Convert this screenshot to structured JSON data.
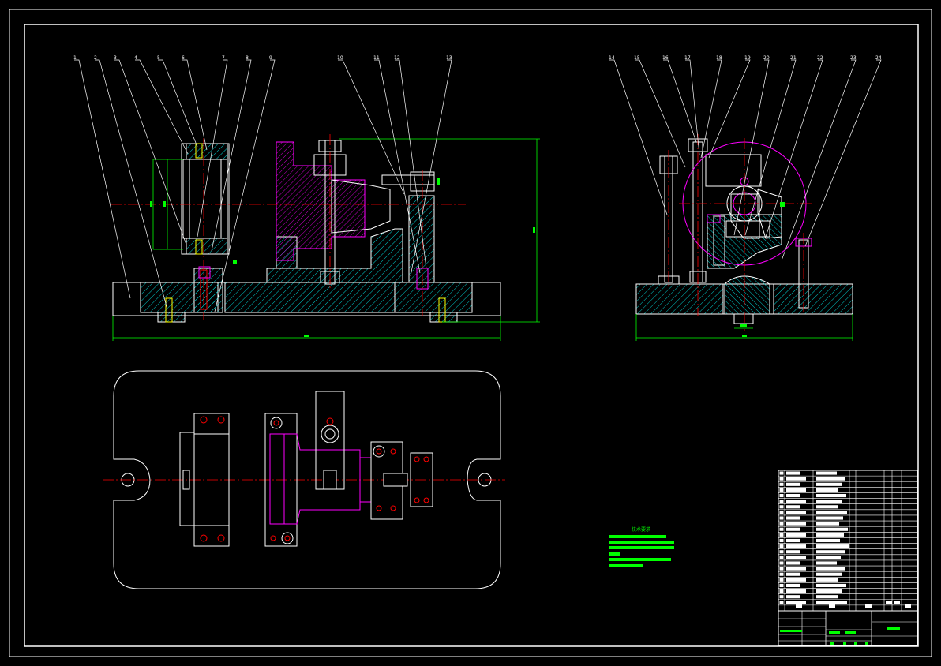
{
  "drawing": {
    "background": "#000000",
    "border_color": "#ffffff",
    "colors": {
      "outline": "#ffffff",
      "hatch": "#00ffff",
      "centerline": "#ff0000",
      "dimension": "#00ff00",
      "workpiece": "#ff00ff",
      "leader": "#ffffff",
      "bolt": "#ffff00"
    }
  },
  "views": {
    "front": {
      "name": "front-section-view"
    },
    "side": {
      "name": "side-section-view"
    },
    "top": {
      "name": "top-plan-view"
    }
  },
  "balloons": {
    "front_left": [
      "1",
      "2",
      "3",
      "4",
      "5",
      "6",
      "7",
      "8",
      "9"
    ],
    "front_right": [
      "10",
      "11",
      "12",
      "13"
    ],
    "side": [
      "14",
      "15",
      "16",
      "17",
      "18",
      "19",
      "20",
      "21",
      "22",
      "23",
      "24"
    ]
  },
  "notes": {
    "title": "技术要求",
    "line_count": 5
  },
  "title_block": {
    "name": "title-block"
  }
}
